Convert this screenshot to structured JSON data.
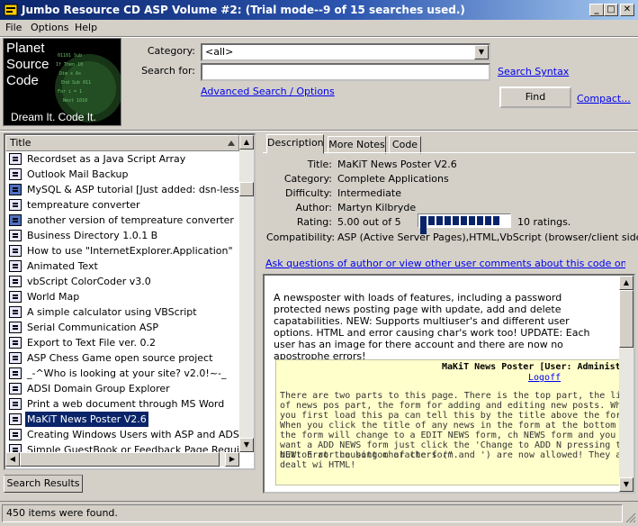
{
  "window": {
    "title": "Jumbo Resource CD ASP Volume #2: (Trial mode--9 of 15 searches used.)",
    "minimize": "_",
    "maximize": "□",
    "close": "✕"
  },
  "menu": [
    "File",
    "Options",
    "Help"
  ],
  "logo": {
    "line1": "Planet",
    "line2": "Source",
    "line3": "Code",
    "tagline": "Dream It.  Code It."
  },
  "search": {
    "category_label": "Category:",
    "category_value": "<all>",
    "searchfor_label": "Search for:",
    "searchfor_value": "",
    "search_syntax": "Search Syntax",
    "advanced": "Advanced Search / Options",
    "find": "Find",
    "compact": "Compact..."
  },
  "list": {
    "header": "Title",
    "items": [
      "Recordset as a Java Script Array",
      "Outlook Mail Backup",
      "MySQL & ASP tutorial   [Just added: dsn-less]",
      "tempreature converter",
      "another version of tempreature converter",
      "Business Directory 1.0.1 B",
      "How to use \"InternetExplorer.Application\"",
      "Animated Text",
      "vbScript ColorCoder v3.0",
      "World Map",
      "A simple calculator using VBScript",
      "Serial Communication ASP",
      "Export to Text File ver. 0.2",
      "ASP Chess Game open source project",
      "_-^Who is looking at your site? v2.0!~-_",
      "ADSI Domain Group Explorer",
      "Print a web document through MS Word",
      "MaKiT News Poster V2.6",
      "Creating Windows Users with ASP and ADSI",
      "Simple GuestBook or Feedback Page Requiring N"
    ],
    "selected_index": 17,
    "tab": "Search Results"
  },
  "tabs": [
    "Description",
    "More Notes",
    "Code"
  ],
  "details": {
    "title_label": "Title:",
    "title": "MaKiT News Poster V2.6",
    "category_label": "Category:",
    "category": "Complete Applications",
    "difficulty_label": "Difficulty:",
    "difficulty": "Intermediate",
    "author_label": "Author:",
    "author": "Martyn Kilbryde",
    "rating_label": "Rating:",
    "rating": "5.00 out of 5",
    "rating_fraction": 1.0,
    "ratings_count": "10 ratings.",
    "compat_label": "Compatibility:",
    "compat": "ASP (Active Server Pages),HTML,VbScript (browser/client side)",
    "ask_link": "Ask questions of author or view other user comments about this code on the web...."
  },
  "description": {
    "text": "A newsposter with loads of features, including a password protected news posting page with update, add and delete capatabilities. NEW: Supports multiuser's and different user options. HTML and error causing char's work too! UPDATE: Each user has an image for there account and there are now no apostrophe errors!",
    "preview_title": "MaKiT News Poster [User: Administra",
    "preview_logoff": "Logoff",
    "preview_body1": "There are two parts to this page. There is the top part, the list of news pos part, the form for adding and editing new posts. When you first load this pa can tell this by the title above the form. When you click the title of any news in the form at the bottom and the form will change to a EDIT NEWS form, ch NEWS form and you want a ADD NEWS form just click the 'Change to ADD N pressing the button at the bottom of the form.",
    "preview_body2": "NEW: Error causing characters (\" and ') are now allowed! They are dealt wi HTML!"
  },
  "status": "450 items were found.",
  "colors": {
    "titlebar": "#0a246a",
    "selection": "#0a246a",
    "link": "#0000ee",
    "preview_bg": "#ffffcc"
  }
}
